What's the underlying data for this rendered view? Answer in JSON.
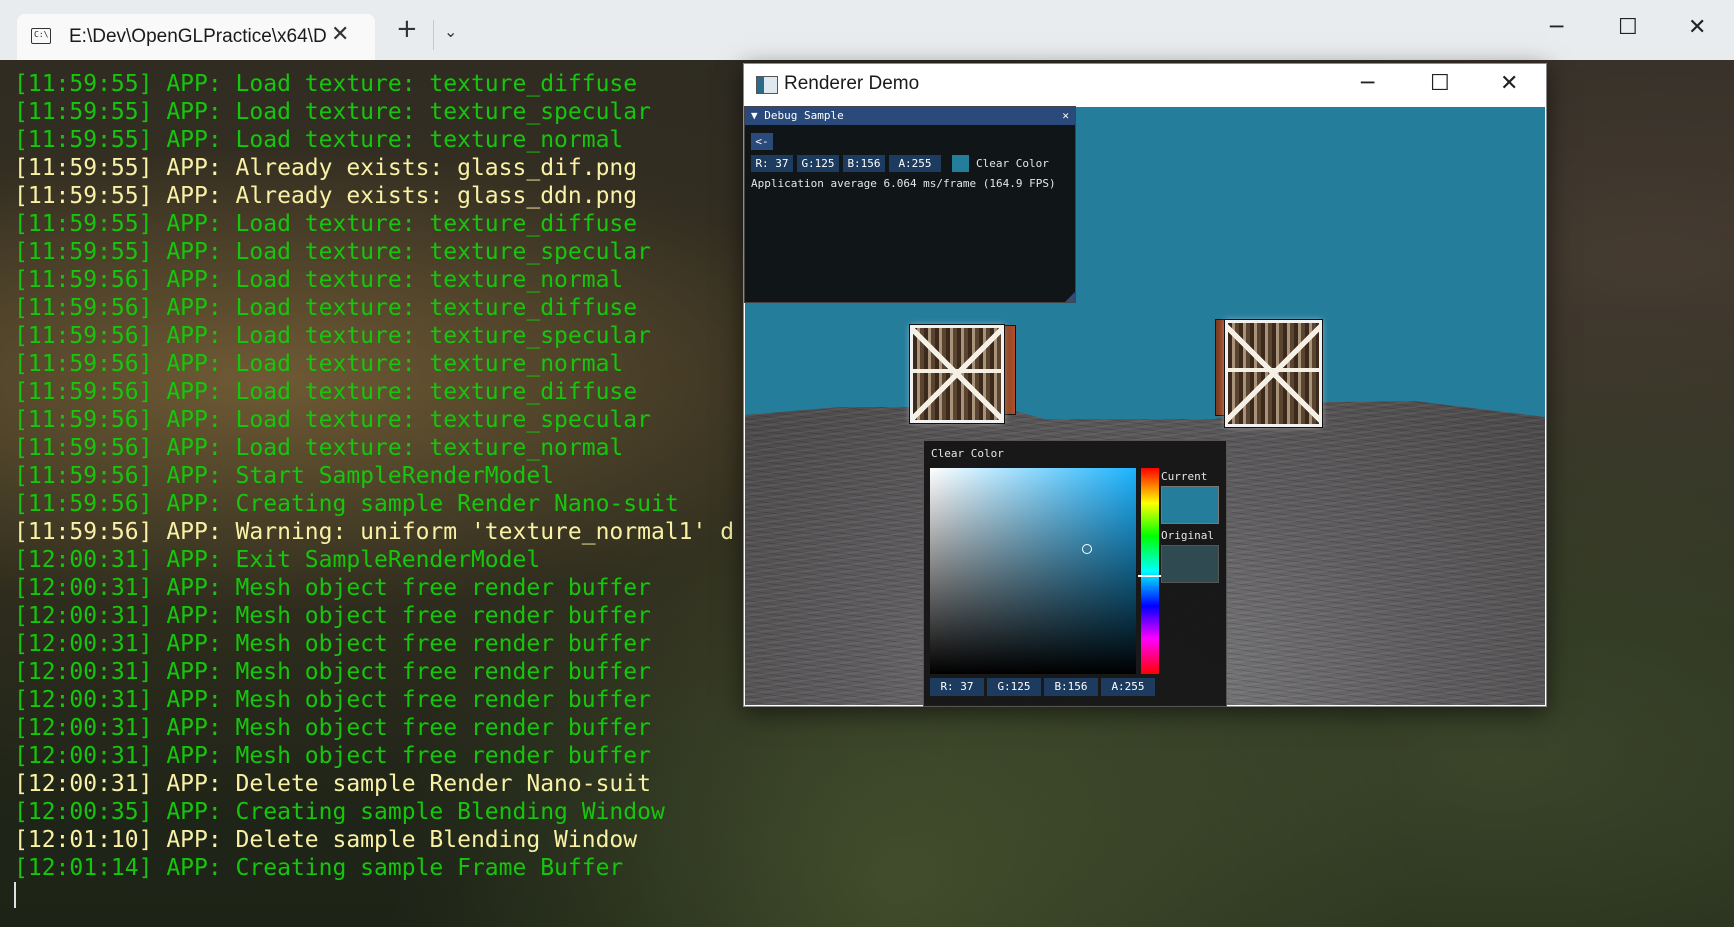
{
  "terminal": {
    "tab_title": "E:\\Dev\\OpenGLPractice\\x64\\D",
    "tab_icon": "console-icon",
    "close_icon": "close-icon",
    "new_tab_icon": "plus-icon",
    "dropdown_icon": "chevron-down-icon",
    "window_controls": {
      "minimize": "─",
      "maximize": "☐",
      "close": "✕"
    },
    "log": [
      {
        "text": "[11:59:55] APP: Load texture: texture_diffuse",
        "color": "#16c60c"
      },
      {
        "text": "[11:59:55] APP: Load texture: texture_specular",
        "color": "#16c60c"
      },
      {
        "text": "[11:59:55] APP: Load texture: texture_normal",
        "color": "#16c60c"
      },
      {
        "text": "[11:59:55] APP: Already exists: glass_dif.png",
        "color": "#f9f1a5"
      },
      {
        "text": "[11:59:55] APP: Already exists: glass_ddn.png",
        "color": "#f9f1a5"
      },
      {
        "text": "[11:59:55] APP: Load texture: texture_diffuse",
        "color": "#16c60c"
      },
      {
        "text": "[11:59:55] APP: Load texture: texture_specular",
        "color": "#16c60c"
      },
      {
        "text": "[11:59:56] APP: Load texture: texture_normal",
        "color": "#16c60c"
      },
      {
        "text": "[11:59:56] APP: Load texture: texture_diffuse",
        "color": "#16c60c"
      },
      {
        "text": "[11:59:56] APP: Load texture: texture_specular",
        "color": "#16c60c"
      },
      {
        "text": "[11:59:56] APP: Load texture: texture_normal",
        "color": "#16c60c"
      },
      {
        "text": "[11:59:56] APP: Load texture: texture_diffuse",
        "color": "#16c60c"
      },
      {
        "text": "[11:59:56] APP: Load texture: texture_specular",
        "color": "#16c60c"
      },
      {
        "text": "[11:59:56] APP: Load texture: texture_normal",
        "color": "#16c60c"
      },
      {
        "text": "[11:59:56] APP: Start SampleRenderModel",
        "color": "#16c60c"
      },
      {
        "text": "[11:59:56] APP: Creating sample Render Nano-suit",
        "color": "#16c60c"
      },
      {
        "text": "[11:59:56] APP: Warning: uniform 'texture_normal1' d",
        "color": "#f9f1a5"
      },
      {
        "text": "[12:00:31] APP: Exit SampleRenderModel",
        "color": "#16c60c"
      },
      {
        "text": "[12:00:31] APP: Mesh object free render buffer",
        "color": "#16c60c"
      },
      {
        "text": "[12:00:31] APP: Mesh object free render buffer",
        "color": "#16c60c"
      },
      {
        "text": "[12:00:31] APP: Mesh object free render buffer",
        "color": "#16c60c"
      },
      {
        "text": "[12:00:31] APP: Mesh object free render buffer",
        "color": "#16c60c"
      },
      {
        "text": "[12:00:31] APP: Mesh object free render buffer",
        "color": "#16c60c"
      },
      {
        "text": "[12:00:31] APP: Mesh object free render buffer",
        "color": "#16c60c"
      },
      {
        "text": "[12:00:31] APP: Mesh object free render buffer",
        "color": "#16c60c"
      },
      {
        "text": "[12:00:31] APP: Delete sample Render Nano-suit",
        "color": "#f9f1a5"
      },
      {
        "text": "[12:00:35] APP: Creating sample Blending Window",
        "color": "#16c60c"
      },
      {
        "text": "[12:01:10] APP: Delete sample Blending Window",
        "color": "#f9f1a5"
      },
      {
        "text": "[12:01:14] APP: Creating sample Frame Buffer",
        "color": "#16c60c"
      }
    ]
  },
  "renderer": {
    "title": "Renderer Demo",
    "window_controls": {
      "minimize": "─",
      "maximize": "☐",
      "close": "✕"
    },
    "clear_color": "#257d9c",
    "debug_panel": {
      "title": "▼ Debug Sample",
      "close": "✕",
      "back_button": "<-",
      "channels": {
        "r": "R: 37",
        "g": "G:125",
        "b": "B:156",
        "a": "A:255"
      },
      "clear_color_label": "Clear Color",
      "fps_text": "Application average 6.064 ms/frame (164.9 FPS)"
    },
    "color_picker": {
      "title": "Clear Color",
      "current_label": "Current",
      "original_label": "Original",
      "original_color": "#2f4a50",
      "channels": {
        "r": "R: 37",
        "g": "G:125",
        "b": "B:156",
        "a": "A:255"
      }
    }
  }
}
